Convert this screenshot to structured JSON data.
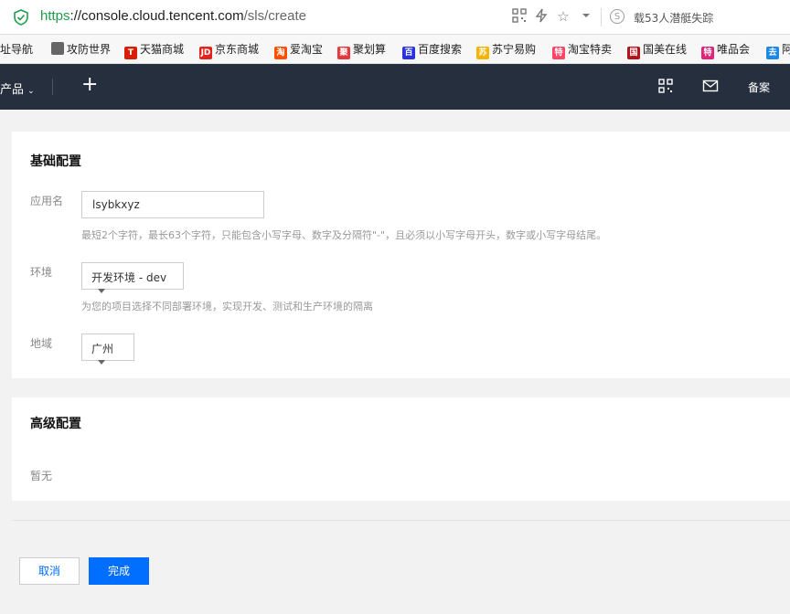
{
  "browser": {
    "url_scheme": "https",
    "url_host": "://console.cloud.tencent.com",
    "url_path": "/sls/create",
    "news_text": "载53人潜艇失踪"
  },
  "bookmarks": [
    {
      "label": "址导航",
      "color": "#3a7bd5",
      "glyph": ""
    },
    {
      "label": "攻防世界",
      "color": "#666666",
      "glyph": ""
    },
    {
      "label": "天猫商城",
      "color": "#d81e06",
      "glyph": "T"
    },
    {
      "label": "京东商城",
      "color": "#e1251b",
      "glyph": "JD"
    },
    {
      "label": "爱淘宝",
      "color": "#ff5000",
      "glyph": "淘"
    },
    {
      "label": "聚划算",
      "color": "#e4393c",
      "glyph": "聚"
    },
    {
      "label": "百度搜索",
      "color": "#2932e1",
      "glyph": "百"
    },
    {
      "label": "苏宁易购",
      "color": "#f5b400",
      "glyph": "苏"
    },
    {
      "label": "淘宝特卖",
      "color": "#ff4466",
      "glyph": "特"
    },
    {
      "label": "国美在线",
      "color": "#b4141c",
      "glyph": "国"
    },
    {
      "label": "唯品会",
      "color": "#e0247a",
      "glyph": "特"
    },
    {
      "label": "阿",
      "color": "#1e88e5",
      "glyph": "去"
    }
  ],
  "topbar": {
    "products_label": "产品",
    "plus_label": "+",
    "beian_label": "备案"
  },
  "basic": {
    "title": "基础配置",
    "app_name_label": "应用名",
    "app_name_value": "lsybkxyz",
    "app_name_help": "最短2个字符，最长63个字符，只能包含小写字母、数字及分隔符\"-\"，且必须以小写字母开头，数字或小写字母结尾。",
    "env_label": "环境",
    "env_value": "开发环境 - dev",
    "env_help": "为您的项目选择不同部署环境，实现开发、测试和生产环境的隔离",
    "region_label": "地域",
    "region_value": "广州"
  },
  "advanced": {
    "title": "高级配置",
    "empty_text": "暂无"
  },
  "actions": {
    "cancel_label": "取消",
    "done_label": "完成"
  }
}
